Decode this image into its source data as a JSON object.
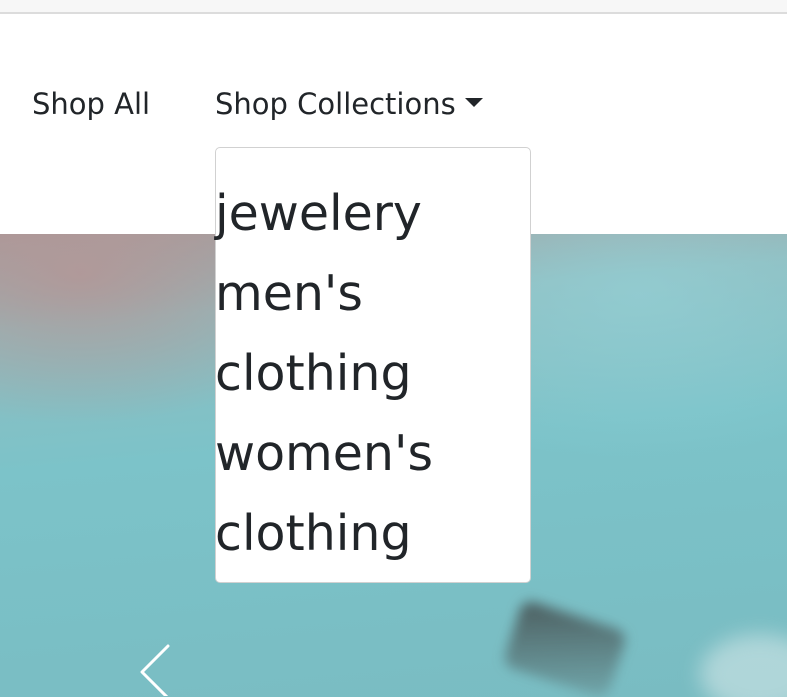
{
  "nav": {
    "shop_all": "Shop All",
    "shop_collections": "Shop Collections"
  },
  "dropdown": {
    "items": [
      {
        "label": "jewelery"
      },
      {
        "label": "men's"
      },
      {
        "label": "clothing"
      },
      {
        "label": "women's"
      },
      {
        "label": "clothing"
      }
    ]
  },
  "carousel": {
    "prev_icon": "chevron-left-icon"
  },
  "colors": {
    "text": "#212529",
    "hero_teal": "#7cc3c9",
    "hero_mauve": "#a79a9a",
    "menu_border": "#d6d6d6"
  }
}
